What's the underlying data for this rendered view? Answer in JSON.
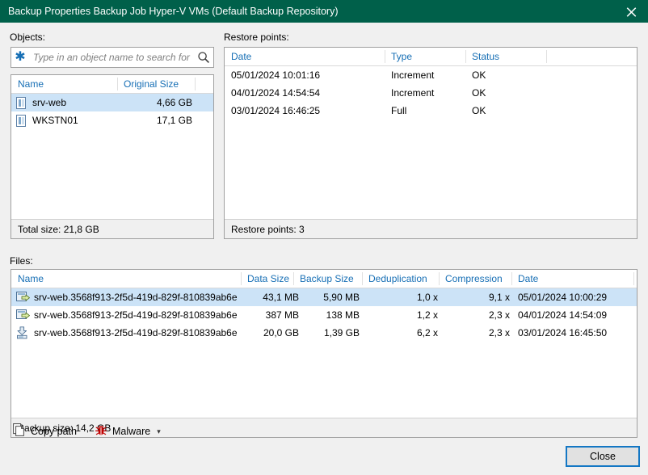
{
  "window": {
    "title": "Backup Properties Backup Job Hyper-V VMs (Default Backup Repository)",
    "close_icon": "close-icon",
    "titlebar_color": "#00604a"
  },
  "objects": {
    "label": "Objects:",
    "search": {
      "placeholder": "Type in an object name to search for",
      "value": "",
      "left_icon": "asterisk-icon",
      "right_icon": "search-icon"
    },
    "columns": [
      "Name",
      "Original Size"
    ],
    "rows": [
      {
        "name": "srv-web",
        "original_size": "4,66 GB",
        "icon": "vm-icon",
        "selected": true
      },
      {
        "name": "WKSTN01",
        "original_size": "17,1 GB",
        "icon": "vm-icon",
        "selected": false
      }
    ],
    "status": "Total size: 21,8 GB"
  },
  "restore_points": {
    "label": "Restore points:",
    "columns": [
      "Date",
      "Type",
      "Status"
    ],
    "rows": [
      {
        "date": "05/01/2024 10:01:16",
        "type": "Increment",
        "status": "OK"
      },
      {
        "date": "04/01/2024 14:54:54",
        "type": "Increment",
        "status": "OK"
      },
      {
        "date": "03/01/2024 16:46:25",
        "type": "Full",
        "status": "OK"
      }
    ],
    "status": "Restore points: 3"
  },
  "files": {
    "label": "Files:",
    "columns": [
      "Name",
      "Data Size",
      "Backup Size",
      "Deduplication",
      "Compression",
      "Date"
    ],
    "rows": [
      {
        "name": "srv-web.3568f913-2f5d-419d-829f-810839ab6e...",
        "data_size": "43,1 MB",
        "backup_size": "5,90 MB",
        "deduplication": "1,0 x",
        "compression": "9,1 x",
        "date": "05/01/2024 10:00:29",
        "icon": "increment-file-icon",
        "selected": true
      },
      {
        "name": "srv-web.3568f913-2f5d-419d-829f-810839ab6e...",
        "data_size": "387 MB",
        "backup_size": "138 MB",
        "deduplication": "1,2 x",
        "compression": "2,3 x",
        "date": "04/01/2024 14:54:09",
        "icon": "increment-file-icon",
        "selected": false
      },
      {
        "name": "srv-web.3568f913-2f5d-419d-829f-810839ab6e...",
        "data_size": "20,0 GB",
        "backup_size": "1,39 GB",
        "deduplication": "6,2 x",
        "compression": "2,3 x",
        "date": "03/01/2024 16:45:50",
        "icon": "full-file-icon",
        "selected": false
      }
    ],
    "status": "Backup size: 14,2 GB"
  },
  "toolbar": {
    "copy_path_label": "Copy path",
    "copy_path_icon": "copy-icon",
    "malware_label": "Malware",
    "malware_icon": "bug-icon",
    "malware_chevron": "chevron-down-icon"
  },
  "footer": {
    "close_label": "Close"
  },
  "colors": {
    "accent": "#00604a",
    "header_text": "#176fb5",
    "selection": "#cce3f7",
    "malware": "#c00000",
    "focus_border": "#1477c4"
  }
}
